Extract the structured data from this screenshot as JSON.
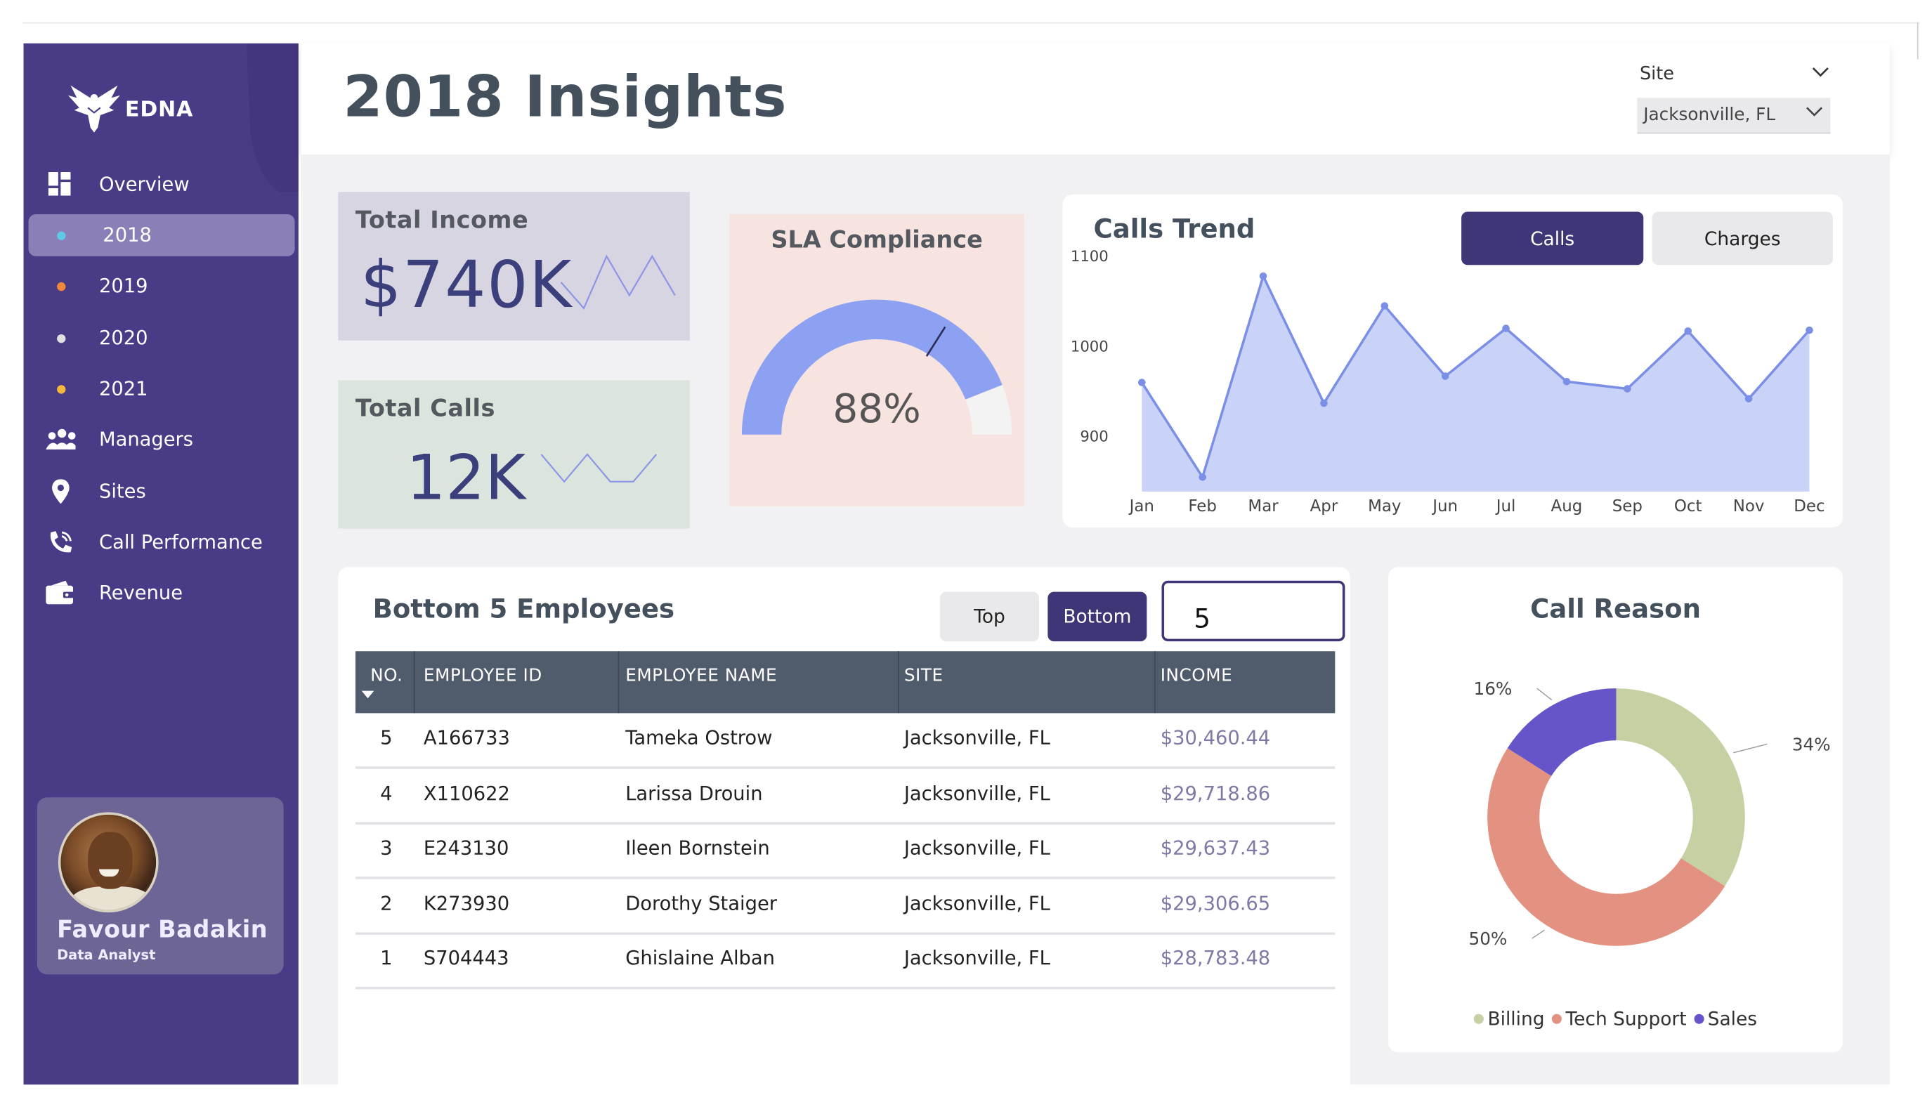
{
  "brand": {
    "name": "EDNA"
  },
  "page": {
    "title": "2018 Insights"
  },
  "filter": {
    "label": "Site",
    "value": "Jacksonville, FL"
  },
  "nav": {
    "items": [
      {
        "label": "Overview",
        "icon": "dashboard-icon"
      },
      {
        "label": "2018",
        "dot_color": "#5ec8e6",
        "active": true
      },
      {
        "label": "2019",
        "dot_color": "#f0883a"
      },
      {
        "label": "2020",
        "dot_color": "#e0e0e0"
      },
      {
        "label": "2021",
        "dot_color": "#f5b83c"
      },
      {
        "label": "Managers",
        "icon": "users-icon"
      },
      {
        "label": "Sites",
        "icon": "location-pin-icon"
      },
      {
        "label": "Call Performance",
        "icon": "phone-icon"
      },
      {
        "label": "Revenue",
        "icon": "wallet-icon"
      }
    ]
  },
  "profile": {
    "name": "Favour Badakin",
    "role": "Data Analyst"
  },
  "kpis": {
    "income": {
      "title": "Total Income",
      "value": "$740K"
    },
    "calls": {
      "title": "Total Calls",
      "value": "12K"
    }
  },
  "sla": {
    "title": "SLA Compliance",
    "value_text": "88%",
    "value": 88,
    "target": 95
  },
  "trend": {
    "title": "Calls Trend",
    "buttons": {
      "calls": "Calls",
      "charges": "Charges"
    }
  },
  "employees": {
    "title": "Bottom 5 Employees",
    "buttons": {
      "top": "Top",
      "bottom": "Bottom"
    },
    "count": "5",
    "columns": [
      "NO.",
      "EMPLOYEE ID",
      "EMPLOYEE NAME",
      "SITE",
      "INCOME"
    ],
    "rows": [
      {
        "no": "5",
        "id": "A166733",
        "name": "Tameka Ostrow",
        "site": "Jacksonville, FL",
        "income": "$30,460.44"
      },
      {
        "no": "4",
        "id": "X110622",
        "name": "Larissa Drouin",
        "site": "Jacksonville, FL",
        "income": "$29,718.86"
      },
      {
        "no": "3",
        "id": "E243130",
        "name": "Ileen Bornstein",
        "site": "Jacksonville, FL",
        "income": "$29,637.43"
      },
      {
        "no": "2",
        "id": "K273930",
        "name": "Dorothy Staiger",
        "site": "Jacksonville, FL",
        "income": "$29,306.65"
      },
      {
        "no": "1",
        "id": "S704443",
        "name": "Ghislaine Alban",
        "site": "Jacksonville, FL",
        "income": "$28,783.48"
      }
    ]
  },
  "reason": {
    "title": "Call Reason"
  },
  "colors": {
    "sidebar": "#4a3b86",
    "accent": "#3f3677",
    "area_fill": "#c9d2f7",
    "line": "#7b8fe6"
  },
  "chart_data": [
    {
      "type": "area",
      "title": "Calls Trend",
      "categories": [
        "Jan",
        "Feb",
        "Mar",
        "Apr",
        "May",
        "Jun",
        "Jul",
        "Aug",
        "Sep",
        "Oct",
        "Nov",
        "Dec"
      ],
      "values": [
        960,
        855,
        1078,
        937,
        1045,
        967,
        1020,
        961,
        953,
        1017,
        942,
        1018
      ],
      "yticks": [
        "1100",
        "1000",
        "900"
      ],
      "ylim": [
        850,
        1100
      ],
      "grid": false
    },
    {
      "type": "pie",
      "title": "Call Reason",
      "labels": [
        "Billing",
        "Tech Support",
        "Sales"
      ],
      "values": [
        34,
        50,
        16
      ],
      "value_labels": [
        "34%",
        "50%",
        "16%"
      ],
      "colors": [
        "#c5d1a3",
        "#e39282",
        "#6555c8"
      ],
      "legend": "bottom"
    },
    {
      "type": "line",
      "title": "Total Income",
      "values": [
        3,
        1,
        5,
        2,
        5,
        2
      ]
    },
    {
      "type": "line",
      "title": "Total Calls",
      "values": [
        4,
        2,
        4,
        2,
        2,
        4
      ]
    }
  ]
}
